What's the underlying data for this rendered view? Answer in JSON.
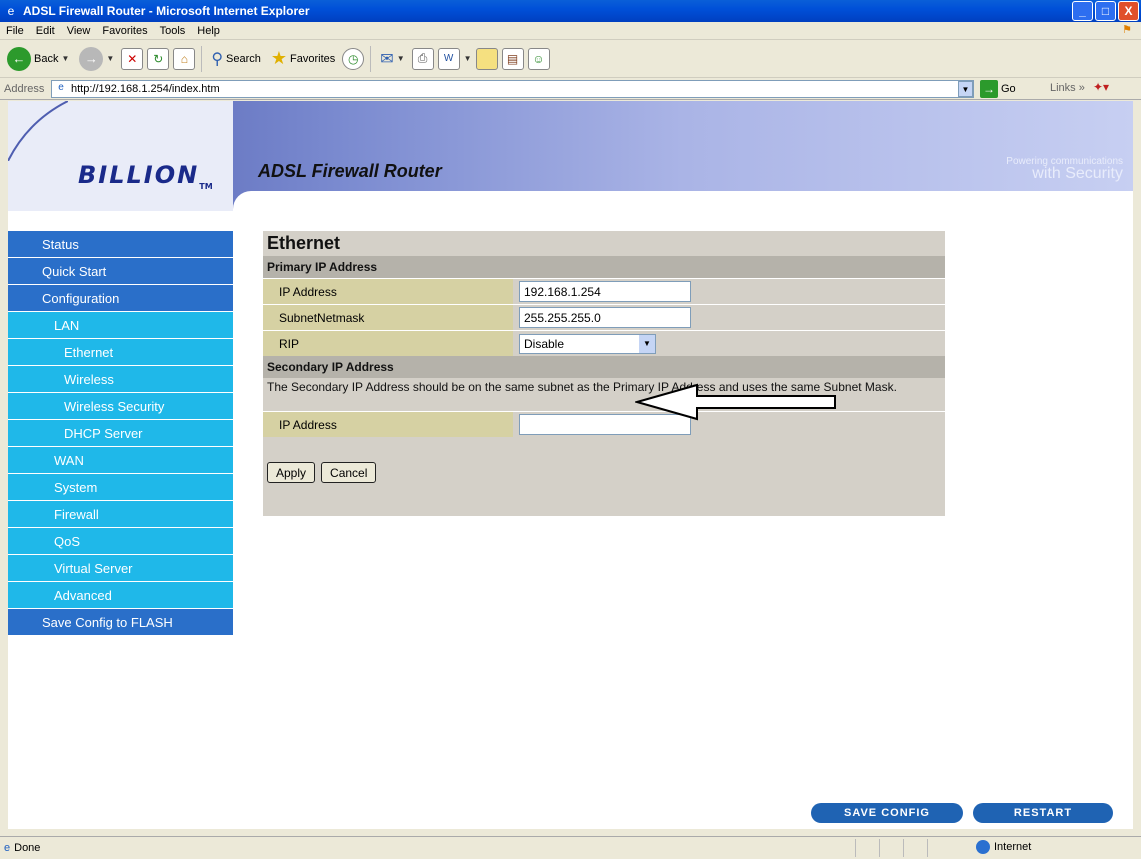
{
  "window": {
    "title": "ADSL Firewall Router - Microsoft Internet Explorer",
    "buttons": [
      "_",
      "□",
      "X"
    ]
  },
  "menu": [
    "File",
    "Edit",
    "View",
    "Favorites",
    "Tools",
    "Help"
  ],
  "toolbar": {
    "back_label": "Back",
    "search_label": "Search",
    "favorites_label": "Favorites"
  },
  "address": {
    "label": "Address",
    "url": "http://192.168.1.254/index.htm",
    "go_label": "Go",
    "links_label": "Links"
  },
  "banner": {
    "logo": "BILLION",
    "logo_tm": "TM",
    "title": "ADSL Firewall Router",
    "tagline_line1": "Powering communications",
    "tagline_line2": "with Security"
  },
  "sidebar": {
    "items": [
      {
        "label": "Status",
        "level": 1
      },
      {
        "label": "Quick Start",
        "level": 1
      },
      {
        "label": "Configuration",
        "level": 1
      },
      {
        "label": "LAN",
        "level": 2
      },
      {
        "label": "Ethernet",
        "level": 3
      },
      {
        "label": "Wireless",
        "level": 3
      },
      {
        "label": "Wireless Security",
        "level": 3
      },
      {
        "label": "DHCP Server",
        "level": 3
      },
      {
        "label": "WAN",
        "level": 2
      },
      {
        "label": "System",
        "level": 2
      },
      {
        "label": "Firewall",
        "level": 2
      },
      {
        "label": "QoS",
        "level": 2
      },
      {
        "label": "Virtual Server",
        "level": 2
      },
      {
        "label": "Advanced",
        "level": 2
      },
      {
        "label": "Save Config to FLASH",
        "level": 1
      }
    ]
  },
  "form": {
    "title": "Ethernet",
    "primary_section": "Primary IP Address",
    "ip_label": "IP Address",
    "ip_value": "192.168.1.254",
    "mask_label": "SubnetNetmask",
    "mask_value": "255.255.255.0",
    "rip_label": "RIP",
    "rip_value": "Disable",
    "secondary_section": "Secondary IP Address",
    "secondary_note": "The Secondary IP Address should be on the same subnet as the Primary IP Address and uses the same Subnet Mask.",
    "secondary_ip_label": "IP Address",
    "secondary_ip_value": "",
    "apply_label": "Apply",
    "cancel_label": "Cancel"
  },
  "footer": {
    "save_config": "SAVE CONFIG",
    "restart": "RESTART"
  },
  "status": {
    "text": "Done",
    "zone": "Internet"
  }
}
